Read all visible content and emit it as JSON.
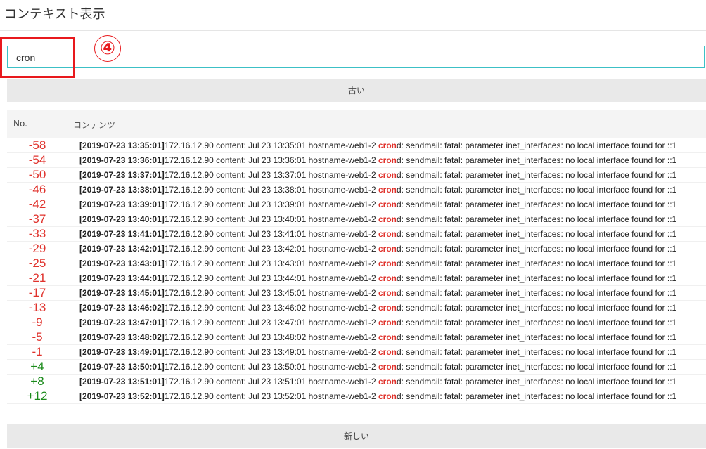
{
  "page": {
    "title": "コンテキスト表示"
  },
  "search": {
    "value": "cron"
  },
  "annotation": {
    "number": "④"
  },
  "buttons": {
    "older": "古い",
    "newer": "新しい"
  },
  "table": {
    "headers": {
      "no": "No.",
      "content": "コンテンツ"
    },
    "rows": [
      {
        "no": "-58",
        "ts": "[2019-07-23 13:35:01]",
        "pre": "172.16.12.90  content: Jul 23 13:35:01 hostname-web1-2 ",
        "hl": "cron",
        "post": "d: sendmail: fatal: parameter inet_interfaces: no local interface found for ::1"
      },
      {
        "no": "-54",
        "ts": "[2019-07-23 13:36:01]",
        "pre": "172.16.12.90  content: Jul 23 13:36:01 hostname-web1-2 ",
        "hl": "cron",
        "post": "d: sendmail: fatal: parameter inet_interfaces: no local interface found for ::1"
      },
      {
        "no": "-50",
        "ts": "[2019-07-23 13:37:01]",
        "pre": "172.16.12.90  content: Jul 23 13:37:01 hostname-web1-2 ",
        "hl": "cron",
        "post": "d: sendmail: fatal: parameter inet_interfaces: no local interface found for ::1"
      },
      {
        "no": "-46",
        "ts": "[2019-07-23 13:38:01]",
        "pre": "172.16.12.90  content: Jul 23 13:38:01 hostname-web1-2 ",
        "hl": "cron",
        "post": "d: sendmail: fatal: parameter inet_interfaces: no local interface found for ::1"
      },
      {
        "no": "-42",
        "ts": "[2019-07-23 13:39:01]",
        "pre": "172.16.12.90  content: Jul 23 13:39:01 hostname-web1-2 ",
        "hl": "cron",
        "post": "d: sendmail: fatal: parameter inet_interfaces: no local interface found for ::1"
      },
      {
        "no": "-37",
        "ts": "[2019-07-23 13:40:01]",
        "pre": "172.16.12.90  content: Jul 23 13:40:01 hostname-web1-2 ",
        "hl": "cron",
        "post": "d: sendmail: fatal: parameter inet_interfaces: no local interface found for ::1"
      },
      {
        "no": "-33",
        "ts": "[2019-07-23 13:41:01]",
        "pre": "172.16.12.90  content: Jul 23 13:41:01 hostname-web1-2 ",
        "hl": "cron",
        "post": "d: sendmail: fatal: parameter inet_interfaces: no local interface found for ::1"
      },
      {
        "no": "-29",
        "ts": "[2019-07-23 13:42:01]",
        "pre": "172.16.12.90  content: Jul 23 13:42:01 hostname-web1-2 ",
        "hl": "cron",
        "post": "d: sendmail: fatal: parameter inet_interfaces: no local interface found for ::1"
      },
      {
        "no": "-25",
        "ts": "[2019-07-23 13:43:01]",
        "pre": "172.16.12.90  content: Jul 23 13:43:01 hostname-web1-2 ",
        "hl": "cron",
        "post": "d: sendmail: fatal: parameter inet_interfaces: no local interface found for ::1"
      },
      {
        "no": "-21",
        "ts": "[2019-07-23 13:44:01]",
        "pre": "172.16.12.90  content: Jul 23 13:44:01 hostname-web1-2 ",
        "hl": "cron",
        "post": "d: sendmail: fatal: parameter inet_interfaces: no local interface found for ::1"
      },
      {
        "no": "-17",
        "ts": "[2019-07-23 13:45:01]",
        "pre": "172.16.12.90  content: Jul 23 13:45:01 hostname-web1-2 ",
        "hl": "cron",
        "post": "d: sendmail: fatal: parameter inet_interfaces: no local interface found for ::1"
      },
      {
        "no": "-13",
        "ts": "[2019-07-23 13:46:02]",
        "pre": "172.16.12.90  content: Jul 23 13:46:02 hostname-web1-2 ",
        "hl": "cron",
        "post": "d: sendmail: fatal: parameter inet_interfaces: no local interface found for ::1"
      },
      {
        "no": "-9",
        "ts": "[2019-07-23 13:47:01]",
        "pre": "172.16.12.90  content: Jul 23 13:47:01 hostname-web1-2 ",
        "hl": "cron",
        "post": "d: sendmail: fatal: parameter inet_interfaces: no local interface found for ::1"
      },
      {
        "no": "-5",
        "ts": "[2019-07-23 13:48:02]",
        "pre": "172.16.12.90  content: Jul 23 13:48:02 hostname-web1-2 ",
        "hl": "cron",
        "post": "d: sendmail: fatal: parameter inet_interfaces: no local interface found for ::1"
      },
      {
        "no": "-1",
        "ts": "[2019-07-23 13:49:01]",
        "pre": "172.16.12.90  content: Jul 23 13:49:01 hostname-web1-2 ",
        "hl": "cron",
        "post": "d: sendmail: fatal: parameter inet_interfaces: no local interface found for ::1"
      },
      {
        "no": "+4",
        "ts": "[2019-07-23 13:50:01]",
        "pre": "172.16.12.90  content: Jul 23 13:50:01 hostname-web1-2 ",
        "hl": "cron",
        "post": "d: sendmail: fatal: parameter inet_interfaces: no local interface found for ::1"
      },
      {
        "no": "+8",
        "ts": "[2019-07-23 13:51:01]",
        "pre": "172.16.12.90  content: Jul 23 13:51:01 hostname-web1-2 ",
        "hl": "cron",
        "post": "d: sendmail: fatal: parameter inet_interfaces: no local interface found for ::1"
      },
      {
        "no": "+12",
        "ts": "[2019-07-23 13:52:01]",
        "pre": "172.16.12.90  content: Jul 23 13:52:01 hostname-web1-2 ",
        "hl": "cron",
        "post": "d: sendmail: fatal: parameter inet_interfaces: no local interface found for ::1"
      }
    ]
  },
  "colors": {
    "negative": "#e0322c",
    "positive": "#1a8a1a",
    "highlight": "#e0322c",
    "focus_border": "#3cc0c6",
    "annotation": "#e8191d"
  }
}
